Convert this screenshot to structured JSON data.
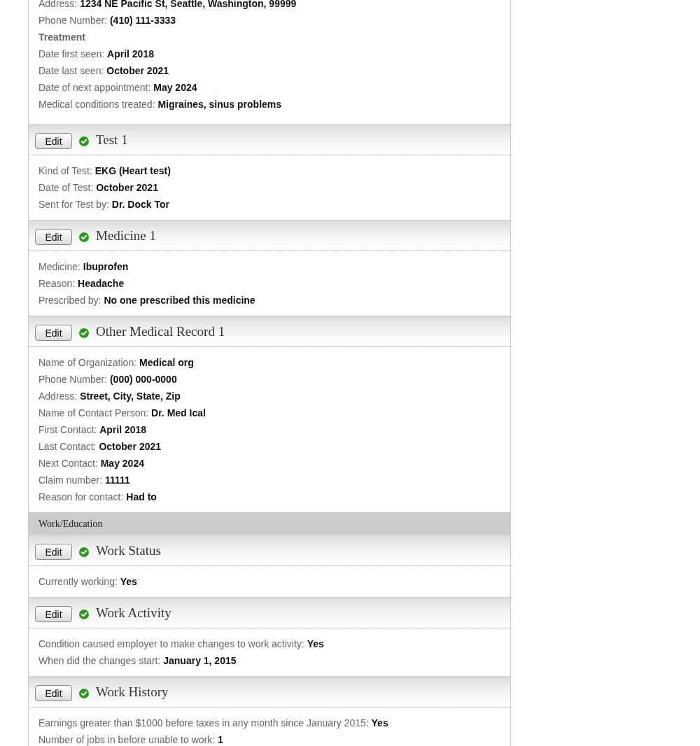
{
  "sections": [
    {
      "kind": "record",
      "fields": [
        {
          "kind": "field",
          "label": "Address:",
          "value": "1234 NE Pacific St, Seattle, Washington, 99999"
        },
        {
          "kind": "field",
          "label": "Phone Number:",
          "value": "(410) 111-3333"
        },
        {
          "kind": "subheading",
          "label": "Treatment"
        },
        {
          "kind": "field",
          "label": "Date first seen:",
          "value": "April 2018"
        },
        {
          "kind": "field",
          "label": "Date last seen:",
          "value": "October 2021"
        },
        {
          "kind": "field",
          "label": "Date of next appointment:",
          "value": "May 2024"
        },
        {
          "kind": "field",
          "label": "Medical conditions treated:",
          "value": "Migraines, sinus problems"
        }
      ]
    },
    {
      "kind": "record",
      "edit": "Edit",
      "complete": true,
      "title": "Test 1",
      "fields": [
        {
          "kind": "field",
          "label": "Kind of Test:",
          "value": "EKG (Heart test)"
        },
        {
          "kind": "field",
          "label": "Date of Test:",
          "value": "October 2021"
        },
        {
          "kind": "field",
          "label": "Sent for Test by:",
          "value": "Dr. Dock Tor"
        }
      ]
    },
    {
      "kind": "record",
      "edit": "Edit",
      "complete": true,
      "title": "Medicine 1",
      "fields": [
        {
          "kind": "field",
          "label": "Medicine:",
          "value": "Ibuprofen"
        },
        {
          "kind": "field",
          "label": "Reason:",
          "value": "Headache"
        },
        {
          "kind": "field",
          "label": "Prescribed by:",
          "value": "No one prescribed this medicine"
        }
      ]
    },
    {
      "kind": "record",
      "edit": "Edit",
      "complete": true,
      "title": "Other Medical Record 1",
      "fields": [
        {
          "kind": "field",
          "label": "Name of Organization:",
          "value": "Medical org"
        },
        {
          "kind": "field",
          "label": "Phone Number:",
          "value": "(000) 000-0000"
        },
        {
          "kind": "field",
          "label": "Address:",
          "value": "Street, City, State, Zip"
        },
        {
          "kind": "field",
          "label": "Name of Contact Person:",
          "value": "Dr. Med Ical"
        },
        {
          "kind": "field",
          "label": "First Contact:",
          "value": "April 2018"
        },
        {
          "kind": "field",
          "label": "Last Contact:",
          "value": "October 2021"
        },
        {
          "kind": "field",
          "label": "Next Contact:",
          "value": "May 2024"
        },
        {
          "kind": "field",
          "label": "Claim number:",
          "value": "11111"
        },
        {
          "kind": "field",
          "label": "Reason for contact:",
          "value": "Had to"
        }
      ]
    },
    {
      "kind": "category",
      "label": "Work/Education"
    },
    {
      "kind": "record",
      "edit": "Edit",
      "complete": true,
      "title": "Work Status",
      "fields": [
        {
          "kind": "field",
          "label": "Currently working:",
          "value": "Yes"
        }
      ]
    },
    {
      "kind": "record",
      "edit": "Edit",
      "complete": true,
      "title": "Work Activity",
      "fields": [
        {
          "kind": "field",
          "label": "Condition caused employer to make changes to work activity:",
          "value": "Yes"
        },
        {
          "kind": "field",
          "label": "When did the changes start:",
          "value": "January 1, 2015"
        }
      ]
    },
    {
      "kind": "record",
      "edit": "Edit",
      "complete": true,
      "title": "Work History",
      "fields": [
        {
          "kind": "field",
          "label": "Earnings greater than $1000 before taxes in any month since January 2015:",
          "value": "Yes"
        },
        {
          "kind": "field",
          "label": "Number of jobs in before unable to work:",
          "value": "1"
        }
      ]
    }
  ]
}
